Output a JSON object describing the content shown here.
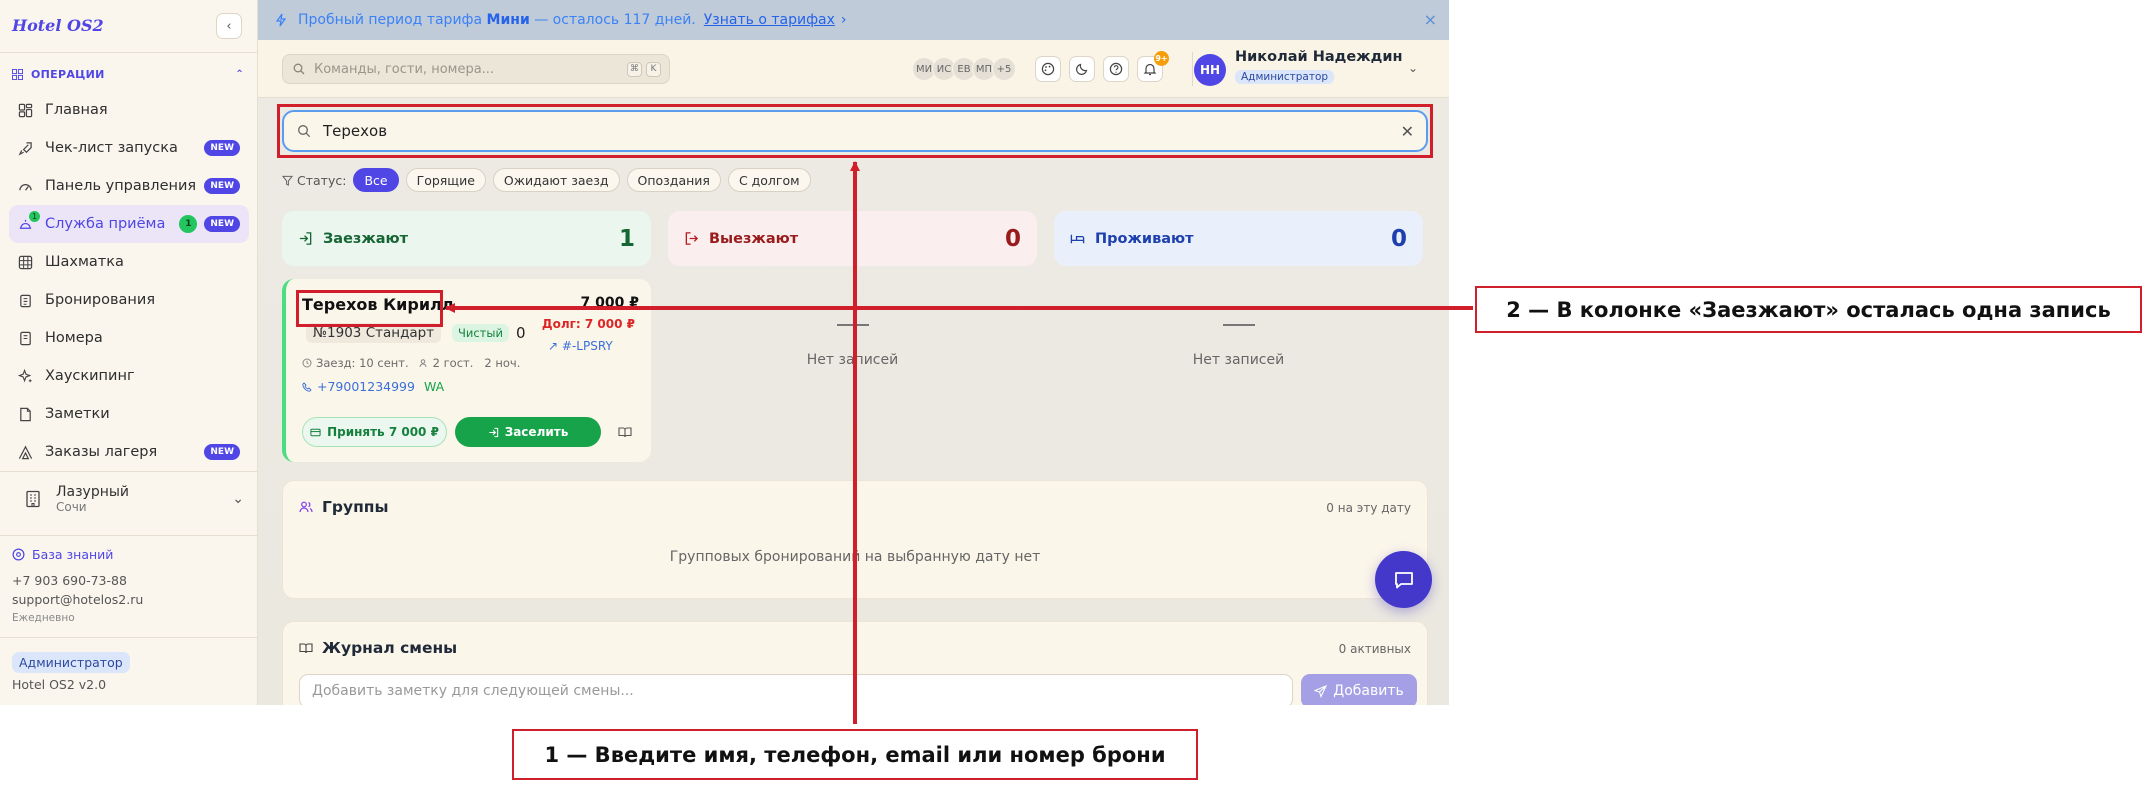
{
  "sidebar": {
    "logo": "Hotel OS2",
    "section": "ОПЕРАЦИИ",
    "items": [
      {
        "label": "Главная",
        "new": false
      },
      {
        "label": "Чек-лист запуска",
        "new": true
      },
      {
        "label": "Панель управления",
        "new": true
      },
      {
        "label": "Служба приёма",
        "new": true,
        "count": "1",
        "dot": "1"
      },
      {
        "label": "Шахматка",
        "new": false
      },
      {
        "label": "Бронирования",
        "new": false
      },
      {
        "label": "Номера",
        "new": false
      },
      {
        "label": "Хаускипинг",
        "new": false
      },
      {
        "label": "Заметки",
        "new": false
      },
      {
        "label": "Заказы лагеря",
        "new": true
      }
    ],
    "new_label": "NEW",
    "hotel_name": "Лазурный",
    "hotel_city": "Сочи",
    "kb_label": "База знаний",
    "phone": "+7 903 690-73-88",
    "email": "support@hotelos2.ru",
    "hours": "Ежедневно",
    "role": "Администратор",
    "version": "Hotel OS2 v2.0"
  },
  "banner": {
    "pre": "Пробный период тарифа",
    "plan": "Мини",
    "post": "— осталось 117 дней.",
    "link": "Узнать о тарифах",
    "close": "×"
  },
  "topbar": {
    "search_placeholder": "Команды, гости, номера...",
    "kbd1": "⌘",
    "kbd2": "K",
    "avatars": [
      "МИ",
      "ИС",
      "ЕВ",
      "МП",
      "+5"
    ],
    "notif_count": "9+",
    "user_initials": "НН",
    "user_name": "Николай Надеждин",
    "user_role": "Администратор"
  },
  "main": {
    "search_value": "Терехов",
    "filter_label": "Статус:",
    "filters": [
      "Все",
      "Горящие",
      "Ожидают заезд",
      "Опоздания",
      "С долгом"
    ],
    "stats": [
      {
        "label": "Заезжают",
        "value": "1"
      },
      {
        "label": "Выезжают",
        "value": "0"
      },
      {
        "label": "Проживают",
        "value": "0"
      }
    ],
    "card": {
      "guest": "Терехов Кирилл",
      "price": "7 000 ₽",
      "debt": "Долг: 7 000 ₽",
      "room": "№1903 Стандарт",
      "status": "Чистый",
      "zero": "0",
      "reservation": "#-LPSRY",
      "checkin_date": "Заезд: 10 сент.",
      "guests": "2 гост.",
      "nights": "2 ноч.",
      "phone": "+79001234999",
      "wa": "WA",
      "pay_label": "Принять 7 000 ₽",
      "checkin_label": "Заселить"
    },
    "empty_text": "Нет записей",
    "groups": {
      "title": "Группы",
      "meta": "0 на эту дату",
      "empty": "Групповых бронирований на выбранную дату нет"
    },
    "shift": {
      "title": "Журнал смены",
      "meta": "0 активных",
      "placeholder": "Добавить заметку для следующей смены...",
      "add_label": "Добавить"
    }
  },
  "annotations": {
    "step1": "1 — Введите имя, телефон, email или номер брони",
    "step2": "2 — В колонке «Заезжают» осталась одна запись",
    "accent_color": "#d01f2a"
  },
  "colors": {
    "brand": "#4f46e5",
    "success": "#16a34a",
    "danger": "#dc2626"
  }
}
